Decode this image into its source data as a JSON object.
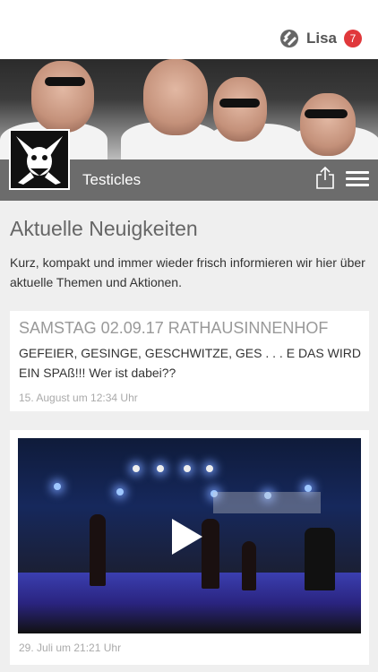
{
  "header": {
    "user_name": "Lisa",
    "notification_count": "7",
    "logo_icon": "app-logo-icon"
  },
  "band": {
    "name": "Testicles",
    "share_icon": "share-icon",
    "menu_icon": "hamburger-menu-icon"
  },
  "news": {
    "heading": "Aktuelle Neuigkeiten",
    "description": "Kurz, kompakt und immer wieder frisch informieren wir hier über aktuelle Themen und Aktionen.",
    "posts": [
      {
        "title": "SAMSTAG 02.09.17 RATHAUSINNENHOF",
        "body": "GEFEIER, GESINGE, GESCHWITZE, GES . . . E DAS WIRD EIN SPAß!!! Wer ist dabei??",
        "time": "15. August um 12:34 Uhr"
      },
      {
        "video": "concert-video",
        "time": "29. Juli um 21:21 Uhr"
      }
    ]
  },
  "colors": {
    "badge": "#e0383b",
    "bar": "#6c6c6c",
    "background": "#efefef"
  }
}
